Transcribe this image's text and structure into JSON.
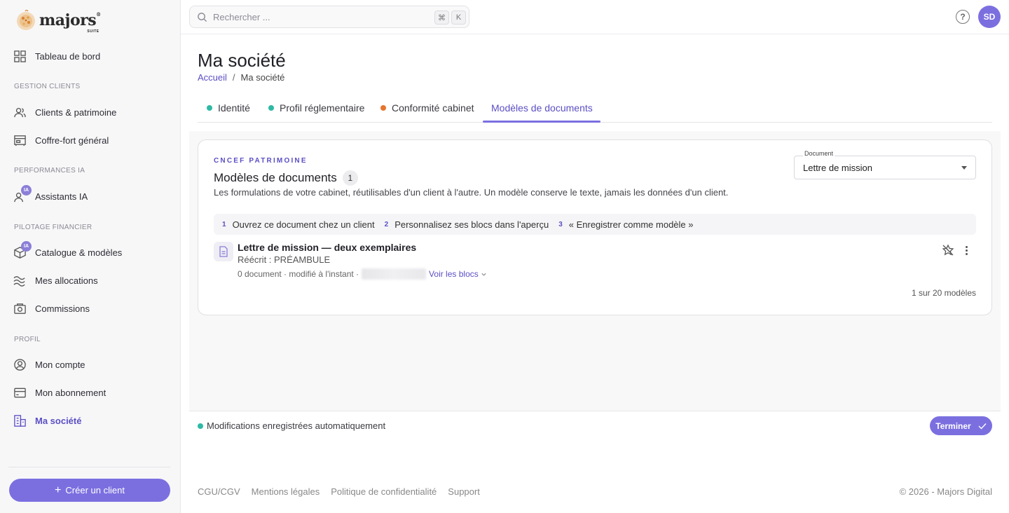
{
  "brand": {
    "name": "majors",
    "sub": "SUITE"
  },
  "colors": {
    "accent": "#7b6fe0",
    "accent_text": "#5b4fc4",
    "teal": "#2fb9a5",
    "orange": "#e5762e"
  },
  "sidebar": {
    "dashboard": "Tableau de bord",
    "sections": {
      "clients": "GESTION CLIENTS",
      "ia": "PERFORMANCES IA",
      "finance": "PILOTAGE FINANCIER",
      "profile": "PROFIL"
    },
    "items": {
      "clients": "Clients & patrimoine",
      "vault": "Coffre-fort général",
      "assistants": "Assistants IA",
      "catalogue": "Catalogue & modèles",
      "allocations": "Mes allocations",
      "commissions": "Commissions",
      "account": "Mon compte",
      "subscription": "Mon abonnement",
      "company": "Ma société"
    },
    "ia_badge": "IA",
    "create_button": "Créer un client"
  },
  "topbar": {
    "search_placeholder": "Rechercher ...",
    "kbd_cmd": "⌘",
    "kbd_k": "K",
    "help": "?",
    "avatar_initials": "SD"
  },
  "page": {
    "title": "Ma société",
    "breadcrumb": {
      "home": "Accueil",
      "sep": "/",
      "current": "Ma société"
    }
  },
  "tabs": [
    {
      "label": "Identité",
      "dot": "#2fb9a5"
    },
    {
      "label": "Profil réglementaire",
      "dot": "#2fb9a5"
    },
    {
      "label": "Conformité cabinet",
      "dot": "#e5762e"
    },
    {
      "label": "Modèles de documents",
      "active": true
    }
  ],
  "card": {
    "eyebrow": "CNCEF PATRIMOINE",
    "title": "Modèles de documents",
    "count": "1",
    "description": "Les formulations de votre cabinet, réutilisables d'un client à l'autre. Un modèle conserve le texte, jamais les données d'un client.",
    "document_select": {
      "label": "Document",
      "value": "Lettre de mission"
    },
    "steps": [
      {
        "num": "1",
        "text": "Ouvrez ce document chez un client"
      },
      {
        "num": "2",
        "text": "Personnalisez ses blocs dans l'aperçu"
      },
      {
        "num": "3",
        "text": "« Enregistrer comme modèle »"
      }
    ],
    "model": {
      "title": "Lettre de mission — deux exemplaires",
      "rewrite": "Réécrit : PRÉAMBULE",
      "meta": "0 document · modifié à l'instant ·",
      "see_blocks": "Voir les blocs"
    },
    "pager": "1 sur 20 modèles"
  },
  "status": {
    "autosave": "Modifications enregistrées automatiquement",
    "finish": "Terminer"
  },
  "footer": {
    "links": [
      "CGU/CGV",
      "Mentions légales",
      "Politique de confidentialité",
      "Support"
    ],
    "copyright": "© 2026 - Majors Digital"
  }
}
